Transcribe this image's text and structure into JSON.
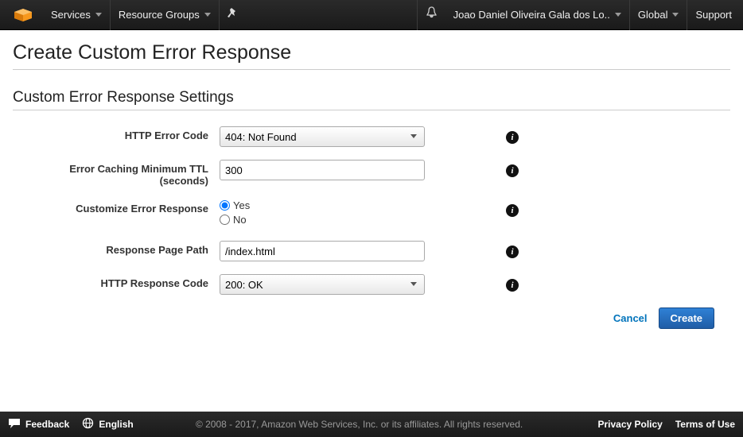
{
  "topbar": {
    "services": "Services",
    "resource_groups": "Resource Groups",
    "user": "Joao Daniel Oliveira Gala dos Lo..",
    "region": "Global",
    "support": "Support"
  },
  "page": {
    "title": "Create Custom Error Response",
    "subtitle": "Custom Error Response Settings"
  },
  "form": {
    "http_error_code": {
      "label": "HTTP Error Code",
      "value": "404: Not Found"
    },
    "ttl": {
      "label": "Error Caching Minimum TTL (seconds)",
      "value": "300"
    },
    "customize": {
      "label": "Customize Error Response",
      "yes": "Yes",
      "no": "No",
      "selected": "yes"
    },
    "page_path": {
      "label": "Response Page Path",
      "value": "/index.html"
    },
    "http_response_code": {
      "label": "HTTP Response Code",
      "value": "200: OK"
    }
  },
  "actions": {
    "cancel": "Cancel",
    "create": "Create"
  },
  "footer": {
    "feedback": "Feedback",
    "language": "English",
    "copyright": "© 2008 - 2017, Amazon Web Services, Inc. or its affiliates. All rights reserved.",
    "privacy": "Privacy Policy",
    "terms": "Terms of Use"
  }
}
